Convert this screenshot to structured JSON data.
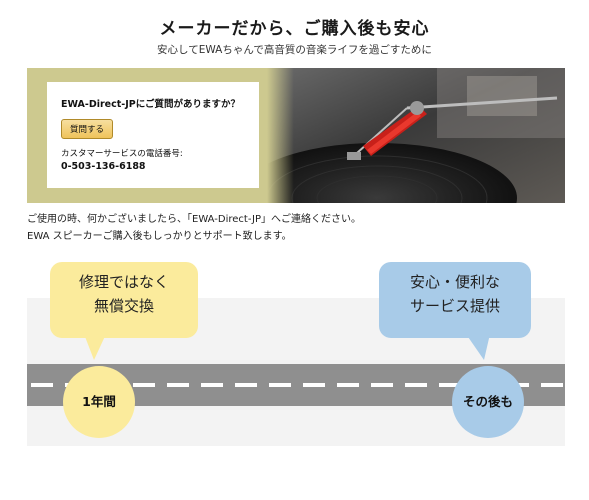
{
  "header": {
    "title": "メーカーだから、ご購入後も安心",
    "subtitle": "安心してEWAちゃんで高音質の音楽ライフを過ごすために"
  },
  "contact": {
    "question": "EWA-Direct-JPにご質問がありますか？",
    "ask_button_label": "質問する",
    "phone_label": "カスタマーサービスの電話番号:",
    "phone_number": "0-503-136-6188"
  },
  "description": {
    "line1": "ご使用の時、何かございましたら、「EWA-Direct-JP」へご連絡ください。",
    "line2": "EWA スピーカーご購入後もしっかりとサポート致します。"
  },
  "timeline": {
    "left_bubble": [
      "修理ではなく",
      "無償交換"
    ],
    "right_bubble": [
      "安心・便利な",
      "サービス提供"
    ],
    "left_circle": "1年間",
    "right_circle": "その後も"
  },
  "colors": {
    "yellow": "#fbeb9c",
    "blue": "#a8cbe8",
    "road": "#8f8f8f",
    "banner_frame": "#cdc98f"
  }
}
